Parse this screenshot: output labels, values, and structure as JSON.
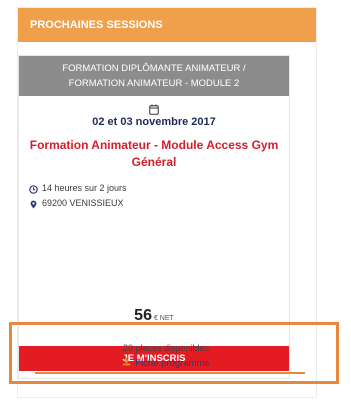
{
  "widget": {
    "header": "PROCHAINES SESSIONS"
  },
  "session": {
    "band_line1": "FORMATION DIPLÔMANTE ANIMATEUR /",
    "band_line2": "FORMATION ANIMATEUR - MODULE 2",
    "date": "02 et 03 novembre 2017",
    "title": "Formation Animateur - Module Access Gym Général",
    "duration": "14 heures sur 2 jours",
    "location": "69200 VENISSIEUX",
    "price_value": "56",
    "price_currency": "€ NET",
    "cta_label": "JE M'INSCRIS",
    "places": "20 places disponibles",
    "program_link": "Fiche programme"
  },
  "icons": {
    "calendar": "calendar-icon",
    "clock": "clock-icon",
    "location": "map-marker-icon",
    "download": "download-icon"
  },
  "colors": {
    "header_bg": "#f0a04b",
    "band_bg": "#8c8c8c",
    "title": "#d11f2b",
    "date": "#1e2a5c",
    "cta_bg": "#e31c24",
    "highlight": "#e8883f"
  }
}
